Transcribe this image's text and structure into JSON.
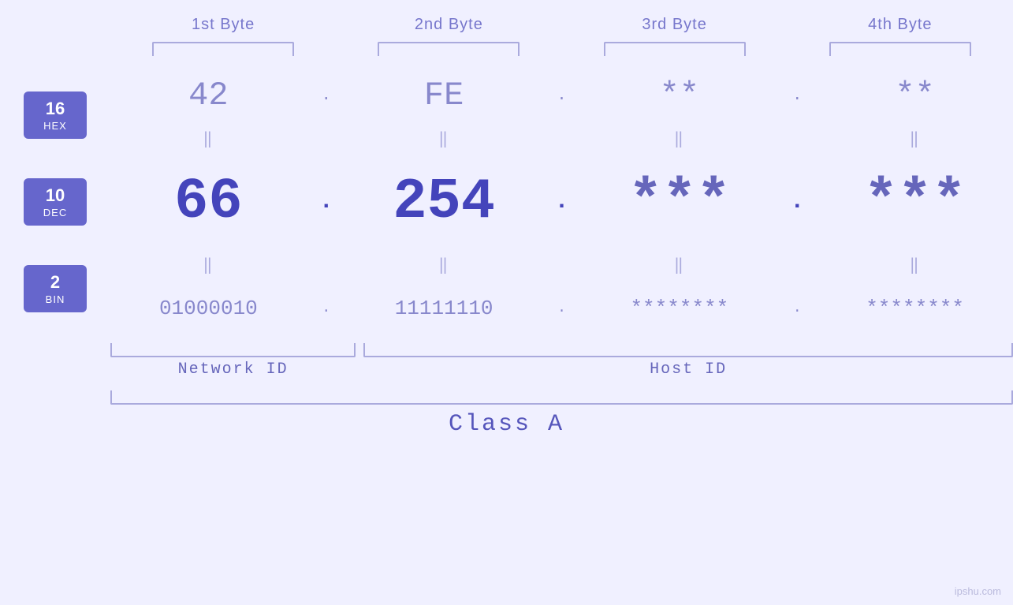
{
  "headers": {
    "byte1": "1st Byte",
    "byte2": "2nd Byte",
    "byte3": "3rd Byte",
    "byte4": "4th Byte"
  },
  "badges": {
    "hex": {
      "number": "16",
      "label": "HEX"
    },
    "dec": {
      "number": "10",
      "label": "DEC"
    },
    "bin": {
      "number": "2",
      "label": "BIN"
    }
  },
  "hex_row": {
    "b1": "42",
    "b2": "FE",
    "b3": "**",
    "b4": "**",
    "dots": [
      ".",
      ".",
      ".",
      ""
    ]
  },
  "dec_row": {
    "b1": "66",
    "b2": "254",
    "b3": "***",
    "b4": "***",
    "dots": [
      ".",
      ".",
      ".",
      ""
    ]
  },
  "bin_row": {
    "b1": "01000010",
    "b2": "11111110",
    "b3": "********",
    "b4": "********",
    "dots": [
      ".",
      ".",
      ".",
      ""
    ]
  },
  "labels": {
    "network_id": "Network ID",
    "host_id": "Host ID",
    "class": "Class A"
  },
  "watermark": "ipshu.com"
}
